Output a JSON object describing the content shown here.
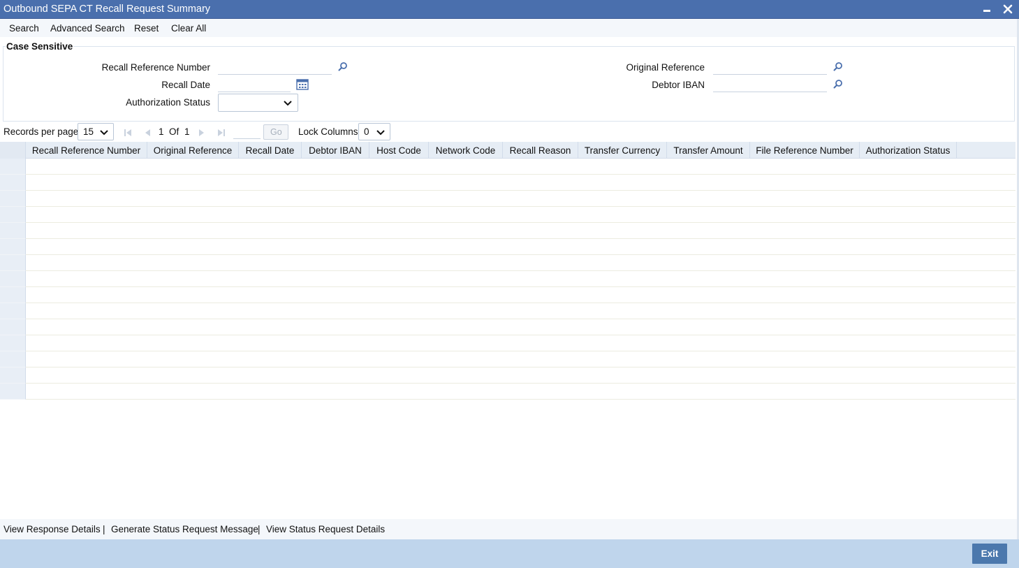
{
  "window": {
    "title": "Outbound SEPA CT Recall Request Summary"
  },
  "menu": {
    "search": "Search",
    "advanced_search": "Advanced Search",
    "reset": "Reset",
    "clear_all": "Clear All"
  },
  "criteria": {
    "legend": "Case Sensitive",
    "recall_reference_number": {
      "label": "Recall Reference Number",
      "value": ""
    },
    "recall_date": {
      "label": "Recall Date",
      "value": ""
    },
    "authorization_status": {
      "label": "Authorization Status",
      "value": ""
    },
    "original_reference": {
      "label": "Original Reference",
      "value": ""
    },
    "debtor_iban": {
      "label": "Debtor IBAN",
      "value": ""
    }
  },
  "pager": {
    "records_per_page_label": "Records per page",
    "records_per_page": "15",
    "current_page": "1",
    "of_label": "Of",
    "total_pages": "1",
    "goto_value": "",
    "go_label": "Go",
    "lock_columns_label": "Lock Columns",
    "lock_columns": "0"
  },
  "grid": {
    "columns": [
      "Recall Reference Number",
      "Original Reference",
      "Recall Date",
      "Debtor IBAN",
      "Host Code",
      "Network Code",
      "Recall Reason",
      "Transfer Currency",
      "Transfer Amount",
      "File Reference Number",
      "Authorization Status"
    ]
  },
  "footer": {
    "view_response_details": "View Response Details",
    "generate_status_request_message": "Generate Status Request Message",
    "view_status_request_details": "View Status Request Details",
    "separator": "|",
    "exit": "Exit"
  },
  "colors": {
    "titlebar": "#4a6fad",
    "footer": "#bfd5ec",
    "exit_button": "#4b78ad",
    "icon": "#4a6fad"
  }
}
